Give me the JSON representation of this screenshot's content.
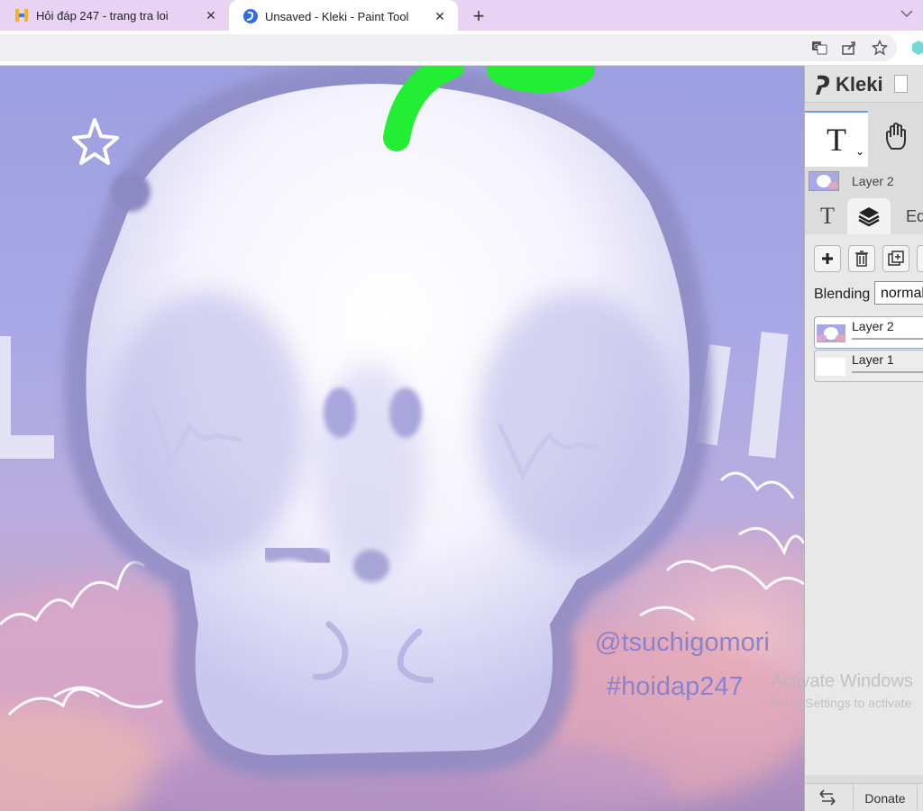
{
  "browser": {
    "tabs": [
      {
        "title": "Hỏi đáp 247 - trang tra loi",
        "active": false,
        "favicon": "hoidap-favicon-icon"
      },
      {
        "title": "Unsaved - Kleki - Paint Tool",
        "active": true,
        "favicon": "kleki-favicon-icon"
      }
    ],
    "new_tab_label": "+",
    "close_label": "✕",
    "toolbar_icons": [
      "translate-icon",
      "share-icon",
      "bookmark-star-icon",
      "extension-icon"
    ]
  },
  "canvas": {
    "watermark_handle": "@tsuchigomori",
    "watermark_tag": "#hoidap247"
  },
  "os_overlay": {
    "line1": "Activate Windows",
    "line2": "Go to Settings to activate"
  },
  "kleki": {
    "logo_text": "Kleki",
    "current_tool": "T",
    "active_layer_name": "Layer 2",
    "panel_tabs": [
      "T",
      "layers-icon",
      "Ed"
    ],
    "layer_buttons": [
      "add-layer-icon",
      "delete-layer-icon",
      "duplicate-layer-icon"
    ],
    "blending_label": "Blending",
    "blending_value": "normal",
    "layers": [
      {
        "name": "Layer 2",
        "selected": true
      },
      {
        "name": "Layer 1",
        "selected": false
      }
    ],
    "footer": {
      "donate_label": "Donate"
    }
  },
  "colors": {
    "tab_strip": "#e9d3f5",
    "canvas_sky": "#a9a8e6",
    "leaf_green": "#22ee33",
    "watermark": "#8a83cc",
    "accent_blue": "#6aa0e0"
  }
}
